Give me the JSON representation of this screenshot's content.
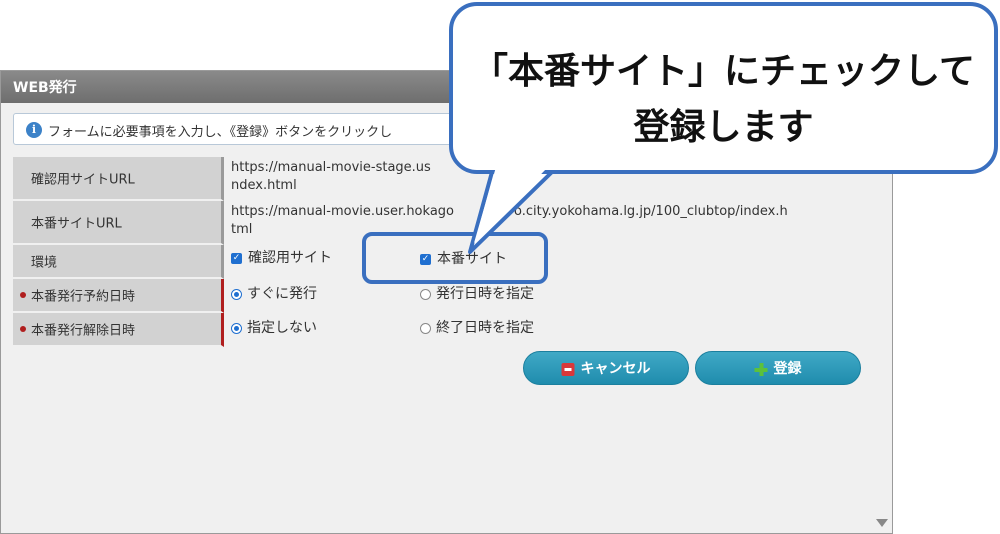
{
  "dialog": {
    "title": "WEB発行",
    "info_message": "フォームに必要事項を入力し、《登録》ボタンをクリックし"
  },
  "form": {
    "rows": [
      {
        "label": "確認用サイトURL",
        "value": "https://manual-movie-stage.us",
        "value2": "ndex.html"
      },
      {
        "label": "本番サイトURL",
        "value": "https://manual-movie.user.hokago",
        "value_tail": "o.city.yokohama.lg.jp/100_clubtop/index.h",
        "value2": "tml"
      },
      {
        "label": "環境",
        "options": [
          "確認用サイト",
          "本番サイト"
        ]
      },
      {
        "label": "本番発行予約日時",
        "options": [
          "すぐに発行",
          "発行日時を指定"
        ]
      },
      {
        "label": "本番発行解除日時",
        "options": [
          "指定しない",
          "終了日時を指定"
        ]
      }
    ]
  },
  "buttons": {
    "cancel": "キャンセル",
    "register": "登録"
  },
  "callout": {
    "line1": "「本番サイト」にチェックして",
    "line2": "登録します"
  }
}
